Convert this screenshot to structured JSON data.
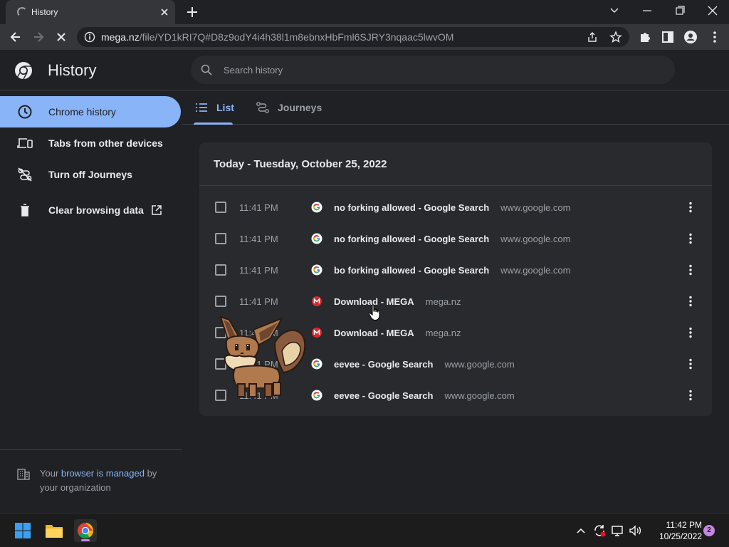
{
  "browser": {
    "tab_title": "History",
    "url_host": "mega.nz",
    "url_path": "/file/YD1kRI7Q#D8z9odY4i4h38l1m8ebnxHbFml6SJRY3nqaac5lwvOM"
  },
  "page": {
    "title": "History",
    "search_placeholder": "Search history"
  },
  "sidebar": {
    "items": [
      {
        "label": "Chrome history",
        "icon": "clock-icon",
        "active": true
      },
      {
        "label": "Tabs from other devices",
        "icon": "devices-icon",
        "active": false
      },
      {
        "label": "Turn off Journeys",
        "icon": "journeys-off-icon",
        "active": false
      },
      {
        "label": "Clear browsing data",
        "icon": "trash-icon",
        "active": false
      }
    ],
    "managed_prefix": "Your ",
    "managed_link": "browser is managed",
    "managed_suffix": " by your organization"
  },
  "tabs": [
    {
      "label": "List",
      "icon": "list-icon",
      "active": true
    },
    {
      "label": "Journeys",
      "icon": "journeys-icon",
      "active": false
    }
  ],
  "history": {
    "date_header": "Today - Tuesday, October 25, 2022",
    "entries": [
      {
        "time": "11:41 PM",
        "title": "no forking allowed - Google Search",
        "domain": "www.google.com",
        "favicon": "google"
      },
      {
        "time": "11:41 PM",
        "title": "no forking allowed - Google Search",
        "domain": "www.google.com",
        "favicon": "google"
      },
      {
        "time": "11:41 PM",
        "title": "bo forking allowed - Google Search",
        "domain": "www.google.com",
        "favicon": "google"
      },
      {
        "time": "11:41 PM",
        "title": "Download - MEGA",
        "domain": "mega.nz",
        "favicon": "mega"
      },
      {
        "time": "11:41 PM",
        "title": "Download - MEGA",
        "domain": "mega.nz",
        "favicon": "mega"
      },
      {
        "time": "11:41 PM",
        "title": "eevee - Google Search",
        "domain": "www.google.com",
        "favicon": "google"
      },
      {
        "time": "11:41 PM",
        "title": "eevee - Google Search",
        "domain": "www.google.com",
        "favicon": "google"
      }
    ]
  },
  "taskbar": {
    "time": "11:42 PM",
    "date": "10/25/2022",
    "notification_count": "2"
  },
  "colors": {
    "accent": "#8ab4f8",
    "background": "#202124",
    "card": "#292a2d",
    "mega_red": "#d9272e"
  }
}
